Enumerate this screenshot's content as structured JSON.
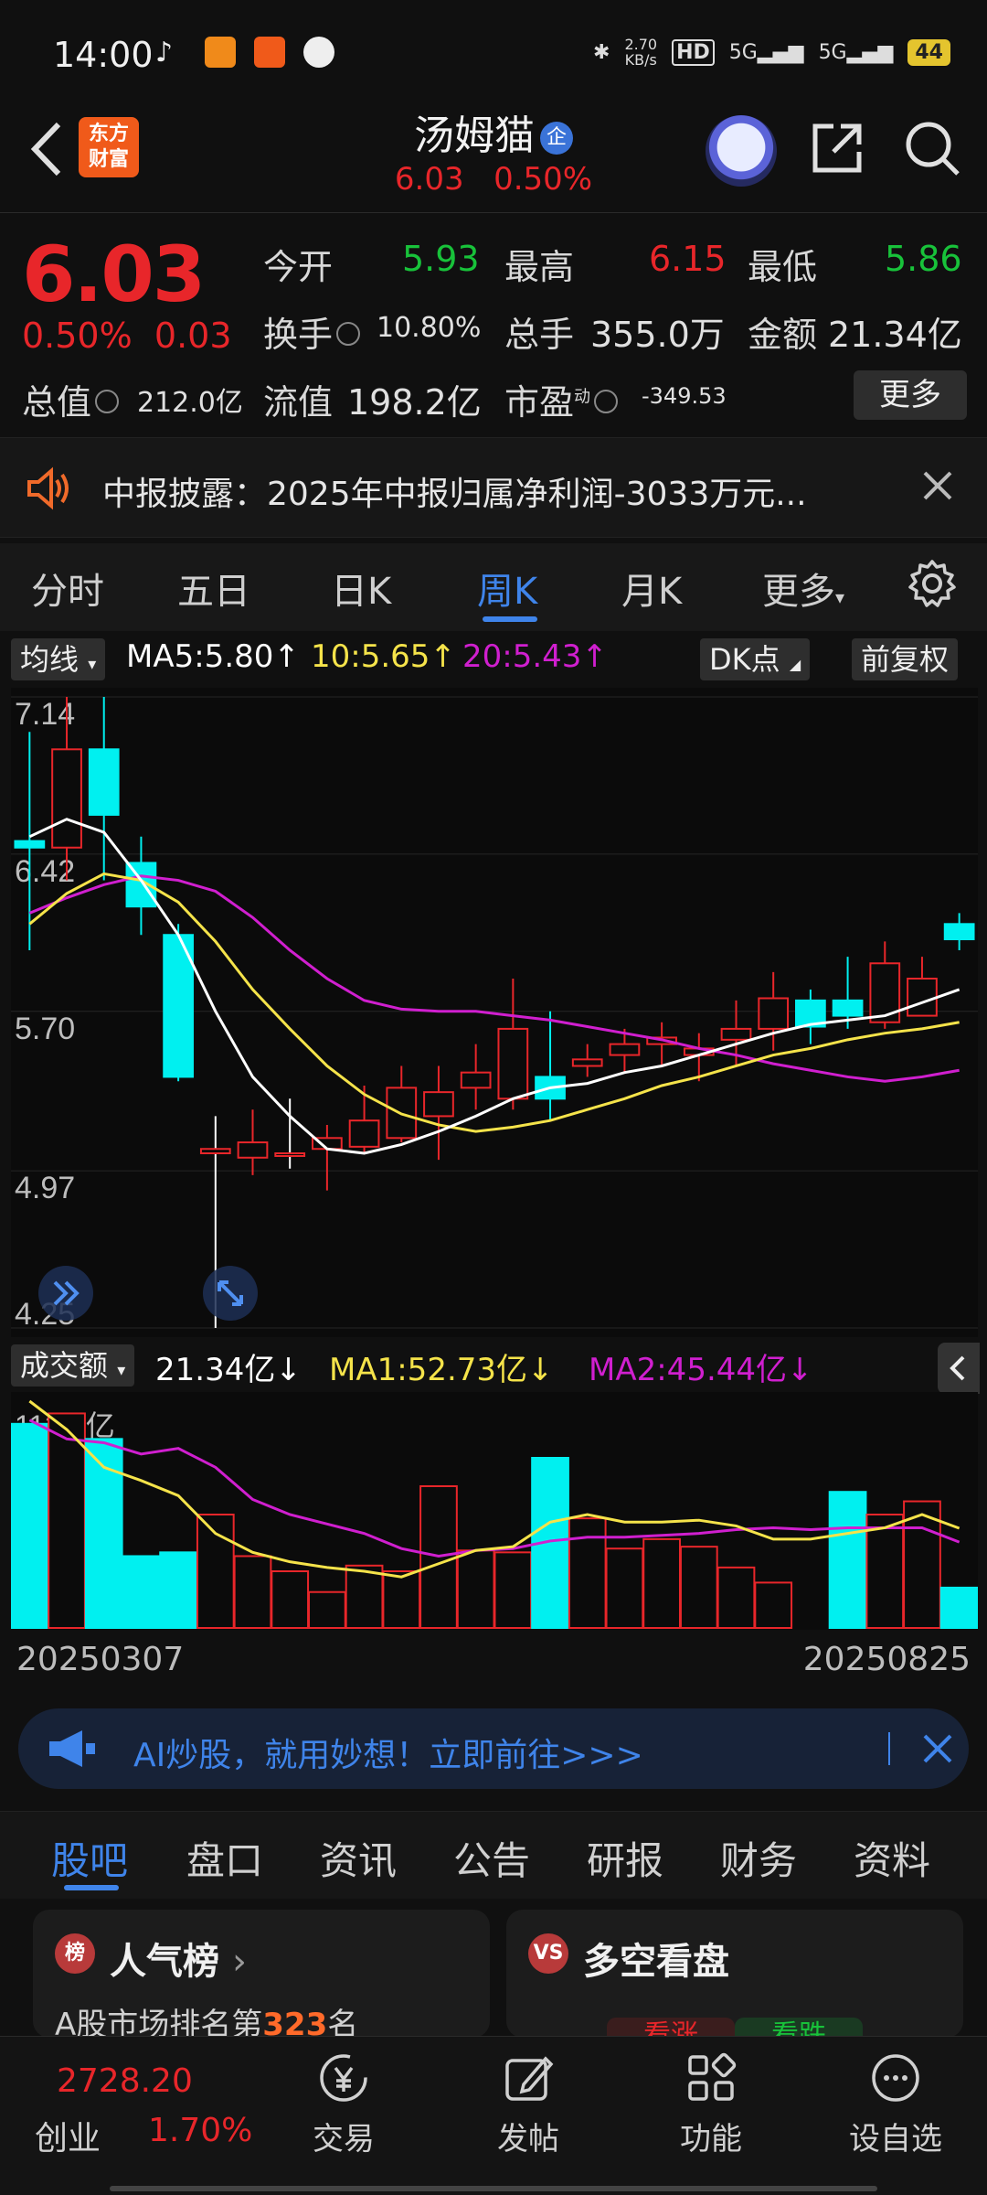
{
  "status": {
    "time": "14:00",
    "net_speed": "2.70",
    "net_unit": "KB/s",
    "hd": "HD",
    "sig1": "5G",
    "sig2": "5G",
    "battery": "44"
  },
  "header": {
    "logo_line1": "东方",
    "logo_line2": "财富",
    "stock_name": "汤姆猫",
    "badge": "企",
    "price": "6.03",
    "change_pct": "0.50%"
  },
  "quote": {
    "price": "6.03",
    "change_pct": "0.50%",
    "change_amt": "0.03",
    "open_label": "今开",
    "open": "5.93",
    "high_label": "最高",
    "high": "6.15",
    "low_label": "最低",
    "low": "5.86",
    "turnover_label": "换手",
    "turnover": "10.80%",
    "volume_label": "总手",
    "volume": "355.0万",
    "amount_label": "金额",
    "amount": "21.34亿",
    "mktcap_label": "总值",
    "mktcap": "212.0亿",
    "float_label": "流值",
    "float": "198.2亿",
    "pe_label": "市盈",
    "pe_sup": "动",
    "pe": "-349.53",
    "more": "更多"
  },
  "notice": {
    "text": "中报披露：2025年中报归属净利润-3033万元..."
  },
  "tabs": [
    "分时",
    "五日",
    "日K",
    "周K",
    "月K",
    "更多"
  ],
  "active_tab": "周K",
  "kline": {
    "indicator": "均线",
    "ma5": "MA5:5.80↑",
    "ma10": "10:5.65↑",
    "ma20": "20:5.43↑",
    "dk": "DK点",
    "adjust": "前复权",
    "yticks": [
      "7.14",
      "6.42",
      "5.70",
      "4.97",
      "4.25"
    ]
  },
  "volume": {
    "indicator": "成交额",
    "value": "21.34亿↓",
    "ma1": "MA1:52.73亿↓",
    "ma2": "MA2:45.44亿↓",
    "ytick": "113.5亿"
  },
  "dates": {
    "start": "20250307",
    "end": "20250825"
  },
  "chart_data": {
    "type": "candlestick",
    "ylim": [
      4.25,
      7.14
    ],
    "x": [
      "20250307",
      "20250314",
      "20250321",
      "20250328",
      "20250403",
      "20250411",
      "20250418",
      "20250425",
      "20250502",
      "20250509",
      "20250516",
      "20250523",
      "20250530",
      "20250606",
      "20250613",
      "20250620",
      "20250627",
      "20250704",
      "20250711",
      "20250718",
      "20250725",
      "20250801",
      "20250808",
      "20250815",
      "20250822",
      "20250825"
    ],
    "open": [
      6.48,
      6.45,
      6.9,
      6.38,
      6.05,
      5.05,
      5.03,
      5.05,
      5.07,
      5.08,
      5.12,
      5.22,
      5.35,
      5.3,
      5.4,
      5.45,
      5.5,
      5.55,
      5.5,
      5.57,
      5.62,
      5.75,
      5.75,
      5.65,
      5.68,
      6.1
    ],
    "close": [
      6.45,
      6.9,
      6.6,
      6.18,
      5.4,
      5.07,
      5.1,
      5.05,
      5.12,
      5.2,
      5.35,
      5.33,
      5.42,
      5.62,
      5.3,
      5.48,
      5.55,
      5.58,
      5.53,
      5.62,
      5.76,
      5.63,
      5.68,
      5.92,
      5.85,
      6.03
    ],
    "high": [
      6.98,
      7.14,
      7.14,
      6.5,
      6.1,
      5.22,
      5.25,
      5.3,
      5.18,
      5.36,
      5.45,
      5.45,
      5.55,
      5.85,
      5.7,
      5.55,
      5.62,
      5.65,
      5.6,
      5.75,
      5.88,
      5.8,
      5.95,
      6.02,
      5.95,
      6.15
    ],
    "low": [
      5.98,
      6.3,
      6.3,
      6.05,
      5.38,
      4.25,
      4.95,
      4.98,
      4.88,
      5.05,
      5.1,
      5.02,
      5.25,
      5.25,
      5.2,
      5.4,
      5.42,
      5.45,
      5.38,
      5.45,
      5.52,
      5.55,
      5.62,
      5.62,
      5.7,
      5.98
    ],
    "ma5": [
      6.5,
      6.58,
      6.52,
      6.3,
      6.05,
      5.7,
      5.4,
      5.22,
      5.07,
      5.05,
      5.09,
      5.15,
      5.22,
      5.3,
      5.35,
      5.37,
      5.42,
      5.45,
      5.5,
      5.55,
      5.6,
      5.64,
      5.66,
      5.68,
      5.74,
      5.8
    ],
    "ma10": [
      6.1,
      6.24,
      6.33,
      6.3,
      6.2,
      6.02,
      5.8,
      5.62,
      5.45,
      5.32,
      5.23,
      5.18,
      5.15,
      5.17,
      5.2,
      5.25,
      5.3,
      5.36,
      5.4,
      5.45,
      5.5,
      5.53,
      5.57,
      5.6,
      5.62,
      5.65
    ],
    "ma20": [
      6.15,
      6.22,
      6.28,
      6.32,
      6.3,
      6.25,
      6.13,
      5.98,
      5.85,
      5.75,
      5.71,
      5.7,
      5.7,
      5.68,
      5.66,
      5.63,
      5.6,
      5.57,
      5.53,
      5.5,
      5.46,
      5.43,
      5.4,
      5.38,
      5.4,
      5.43
    ],
    "volume": [
      108,
      113.5,
      100,
      38,
      40,
      60,
      38,
      30,
      19,
      33,
      30,
      75,
      41,
      40,
      90,
      58,
      42,
      47,
      43,
      32,
      24,
      0,
      72,
      60,
      67,
      21.34
    ],
    "vol_ma1": [
      120,
      105,
      85,
      78,
      70,
      50,
      40,
      35,
      32,
      30,
      27,
      34,
      41,
      43,
      56,
      60,
      56,
      56,
      57,
      54,
      47,
      47,
      50,
      53,
      60,
      52.73
    ],
    "vol_ma2": [
      110,
      100,
      98,
      92,
      95,
      85,
      68,
      60,
      55,
      50,
      42,
      38,
      41,
      42,
      46,
      48,
      48,
      49,
      50,
      52,
      53,
      52,
      53,
      53,
      53,
      45.44
    ]
  },
  "ai_banner": {
    "text": "AI炒股，就用妙想！立即前往>>>"
  },
  "section_tabs": [
    "股吧",
    "盘口",
    "资讯",
    "公告",
    "研报",
    "财务",
    "资料"
  ],
  "active_section": "股吧",
  "cards": {
    "left": {
      "icon": "榜",
      "title": "人气榜",
      "sub_prefix": "A股市场排名第",
      "rank": "323",
      "sub_suffix": "名"
    },
    "right": {
      "icon": "VS",
      "title": "多空看盘",
      "up": "看涨",
      "down": "看跌"
    }
  },
  "bottom": {
    "index_value": "2728.20",
    "index_name": "创业",
    "index_pct": "1.70%",
    "items": [
      "交易",
      "发帖",
      "功能",
      "设自选"
    ]
  },
  "colors": {
    "up": "#e8262a",
    "down": "#00f0f0",
    "accent": "#3f84ea",
    "ma5": "#ffffff",
    "ma10": "#f5e34a",
    "ma20": "#d01fcf"
  }
}
